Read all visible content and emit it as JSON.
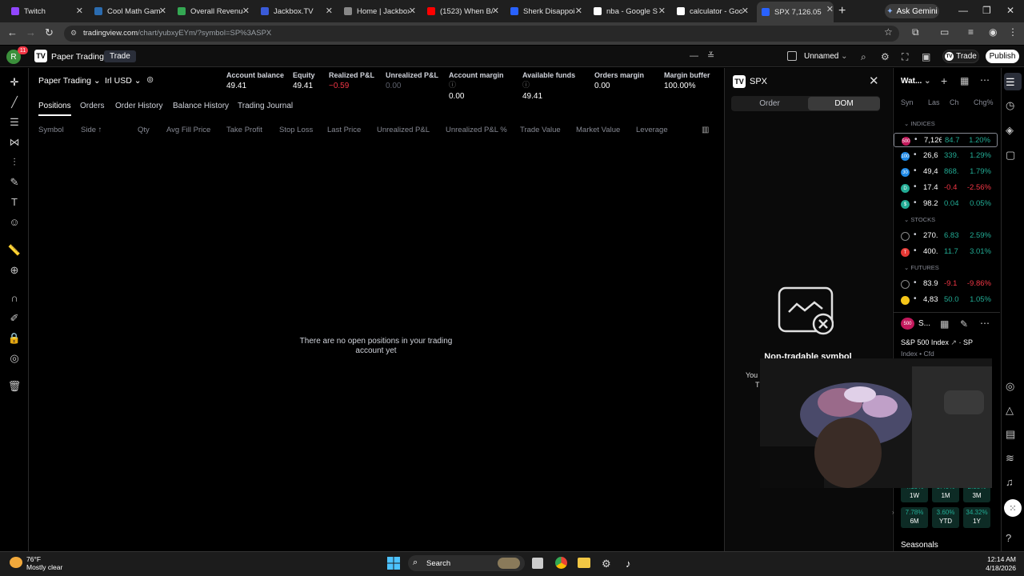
{
  "browser": {
    "tabs": [
      {
        "title": "Twitch",
        "icon": "twitch-icon"
      },
      {
        "title": "Cool Math Gam",
        "icon": "coolmath-icon"
      },
      {
        "title": "Overall Revenue",
        "icon": "sheets-icon"
      },
      {
        "title": "Jackbox.TV",
        "icon": "jackbox-icon"
      },
      {
        "title": "Home | Jackbox",
        "icon": "jackbox-home-icon"
      },
      {
        "title": "(1523) When B/",
        "icon": "youtube-icon"
      },
      {
        "title": "Sherk Disappoi",
        "icon": "app-icon"
      },
      {
        "title": "nba - Google S",
        "icon": "google-icon"
      },
      {
        "title": "calculator - Goo",
        "icon": "google-icon"
      },
      {
        "title": "SPX 7,126.05 ▲",
        "icon": "tradingview-icon"
      }
    ],
    "gemini_label": "Ask Gemini",
    "url_host": "tradingview.com",
    "url_path": "/chart/yubxyEYm/?symbol=SP%3ASPX"
  },
  "tv_header": {
    "notification_count": "11",
    "avatar_letter": "R",
    "brand_label": "Paper Trading",
    "trade_tab": "Trade",
    "layout_name": "Unnamed",
    "trade_button": "Trade",
    "publish_button": "Publish"
  },
  "account": {
    "selector": "Paper Trading",
    "currency": "Irl USD",
    "stats": [
      {
        "label": "Account balance",
        "value": "49.41"
      },
      {
        "label": "Equity",
        "value": "49.41"
      },
      {
        "label": "Realized P&L",
        "value": "−0.59"
      },
      {
        "label": "Unrealized P&L",
        "value": "0.00"
      },
      {
        "label": "Account margin",
        "value": "0.00"
      },
      {
        "label": "Available funds",
        "value": "49.41"
      },
      {
        "label": "Orders margin",
        "value": "0.00"
      },
      {
        "label": "Margin buffer",
        "value": "100.00%"
      }
    ]
  },
  "sub_tabs": [
    "Positions",
    "Orders",
    "Order History",
    "Balance History",
    "Trading Journal"
  ],
  "columns": [
    "Symbol",
    "Side ↑",
    "Qty",
    "Avg Fill Price",
    "Take Profit",
    "Stop Loss",
    "Last Price",
    "Unrealized P&L",
    "Unrealized P&L %",
    "Trade Value",
    "Market Value",
    "Leverage"
  ],
  "empty_message_line1": "There are no open positions in your trading",
  "empty_message_line2": "account yet",
  "dom_panel": {
    "symbol": "SPX",
    "tab_order": "Order",
    "tab_dom": "DOM",
    "non_tradable": "Non-tradable symbol",
    "partial_text_1": "You",
    "partial_text_2": "T"
  },
  "watchlist": {
    "title": "Wat...",
    "headers": [
      "Syn",
      "Las",
      "Ch",
      "Chg%"
    ],
    "sections": [
      {
        "name": "INDICES",
        "rows": [
          {
            "badge": "500",
            "badge_color": "#c2185b",
            "last": "7,126",
            "chg": "84.7",
            "pct": "1.20%",
            "dir": "up",
            "selected": true
          },
          {
            "badge": "100",
            "badge_color": "#1e88e5",
            "last": "26,6",
            "chg": "339.",
            "pct": "1.29%",
            "dir": "up"
          },
          {
            "badge": "30",
            "badge_color": "#1e88e5",
            "last": "49,4",
            "chg": "868.",
            "pct": "1.79%",
            "dir": "up"
          },
          {
            "badge": "D",
            "badge_color": "#22ab94",
            "last": "17.4",
            "chg": "-0.4",
            "pct": "-2.56%",
            "dir": "dn"
          },
          {
            "badge": "$",
            "badge_color": "#22ab94",
            "last": "98.2",
            "chg": "0.04",
            "pct": "0.05%",
            "dir": "up"
          }
        ]
      },
      {
        "name": "STOCKS",
        "rows": [
          {
            "badge": "",
            "badge_color": "#000000",
            "last": "270.",
            "chg": "6.83",
            "pct": "2.59%",
            "dir": "up"
          },
          {
            "badge": "T",
            "badge_color": "#e53935",
            "last": "400.",
            "chg": "11.7",
            "pct": "3.01%",
            "dir": "up"
          }
        ]
      },
      {
        "name": "FUTURES",
        "rows": [
          {
            "badge": "",
            "badge_color": "#000000",
            "last": "83.9",
            "chg": "-9.1",
            "pct": "-9.86%",
            "dir": "dn"
          },
          {
            "badge": "",
            "badge_color": "#f5c518",
            "last": "4,83",
            "chg": "50.0",
            "pct": "1.05%",
            "dir": "up"
          }
        ]
      }
    ]
  },
  "symbol_detail": {
    "badge": "500",
    "short": "S...",
    "name": "S&P 500 Index",
    "exchange": "SP",
    "meta": "Index • Cfd",
    "performance": [
      {
        "value": "4.19%",
        "period": "1W"
      },
      {
        "value": "0.40%",
        "period": "1M"
      },
      {
        "value": "2.38%",
        "period": "3M"
      },
      {
        "value": "7.78%",
        "period": "6M"
      },
      {
        "value": "3.60%",
        "period": "YTD"
      },
      {
        "value": "34.32%",
        "period": "1Y"
      }
    ],
    "seasonals": "Seasonals"
  },
  "taskbar": {
    "temperature": "76°F",
    "weather": "Mostly clear",
    "search": "Search",
    "time": "12:14 AM",
    "date": "4/18/2026"
  }
}
